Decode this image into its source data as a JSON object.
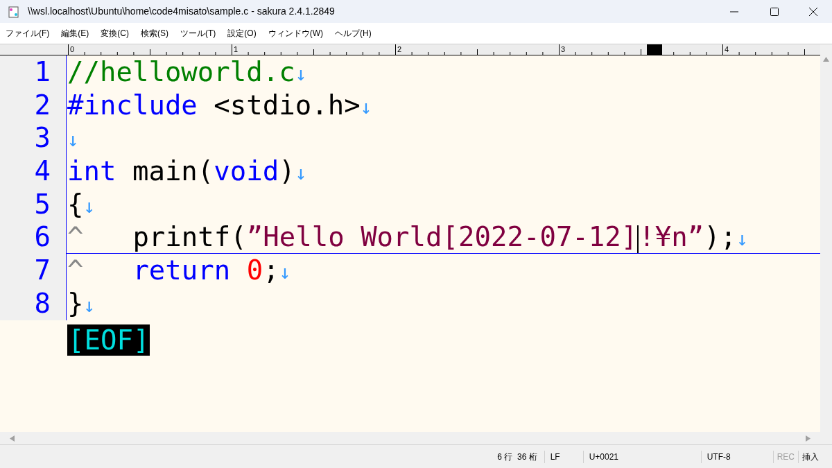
{
  "window": {
    "title": "\\\\wsl.localhost\\Ubuntu\\home\\code4misato\\sample.c - sakura 2.4.1.2849"
  },
  "menu": [
    "ファイル(F)",
    "編集(E)",
    "変換(C)",
    "検索(S)",
    "ツール(T)",
    "設定(O)",
    "ウィンドウ(W)",
    "ヘルプ(H)"
  ],
  "ruler": {
    "labels": [
      "0",
      "1",
      "2",
      "3",
      "4"
    ]
  },
  "editor": {
    "eof": "[EOF]",
    "lines": [
      {
        "number": "1",
        "current": false,
        "eol": "↓",
        "tokens": [
          {
            "kind": "comment",
            "text": "//helloworld.c"
          }
        ]
      },
      {
        "number": "2",
        "current": false,
        "eol": "↓",
        "tokens": [
          {
            "kind": "keyword",
            "text": "#include"
          },
          {
            "kind": "text",
            "text": " <stdio.h>"
          }
        ]
      },
      {
        "number": "3",
        "current": false,
        "eol": "↓"
      },
      {
        "number": "4",
        "current": false,
        "eol": "↓",
        "tokens": [
          {
            "kind": "keyword",
            "text": "int"
          },
          {
            "kind": "text",
            "text": " main("
          },
          {
            "kind": "keyword",
            "text": "void"
          },
          {
            "kind": "text",
            "text": ")"
          }
        ]
      },
      {
        "number": "5",
        "current": false,
        "eol": "↓",
        "tokens": [
          {
            "kind": "text",
            "text": "{"
          }
        ]
      },
      {
        "number": "6",
        "current": true,
        "eol": "↓",
        "tokens": [
          {
            "kind": "tab",
            "text": "^"
          },
          {
            "kind": "text",
            "text": "printf("
          },
          {
            "kind": "string",
            "text": "”Hello World[2022-07-12]"
          },
          {
            "kind": "cursor"
          },
          {
            "kind": "string",
            "text": "!¥n”"
          },
          {
            "kind": "text",
            "text": ");"
          }
        ]
      },
      {
        "number": "7",
        "current": false,
        "eol": "↓",
        "tokens": [
          {
            "kind": "tab",
            "text": "^"
          },
          {
            "kind": "keyword",
            "text": "return "
          },
          {
            "kind": "number",
            "text": "0"
          },
          {
            "kind": "text",
            "text": ";"
          }
        ]
      },
      {
        "number": "8",
        "current": false,
        "eol": "↓",
        "tokens": [
          {
            "kind": "text",
            "text": "}"
          }
        ]
      }
    ]
  },
  "status_bar": {
    "position": "6 行  36 桁",
    "line_ending": "LF",
    "codepoint": "U+0021",
    "encoding": "UTF-8",
    "rec": {
      "label": "REC",
      "on": false
    },
    "mode": "挿入"
  }
}
